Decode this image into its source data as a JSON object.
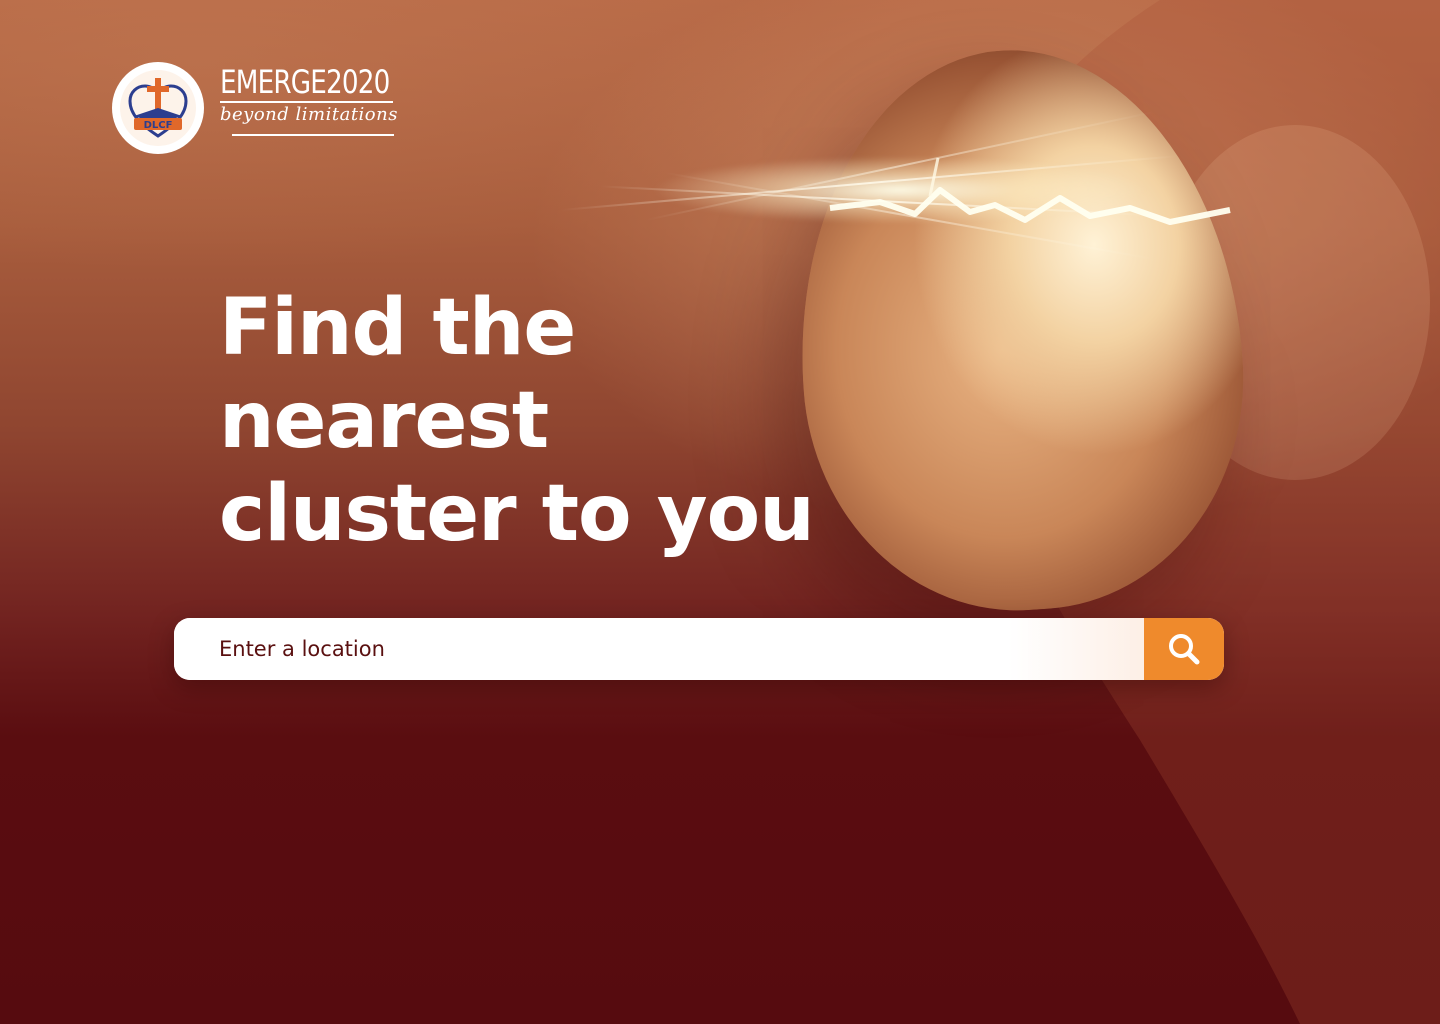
{
  "brand": {
    "name": "EMERGE2020",
    "tagline": "beyond limitations",
    "logo_text": "DLCF",
    "logo_icon": "cross-heart-logo"
  },
  "hero": {
    "headline_lines": [
      "Find the",
      "nearest",
      "cluster to you"
    ],
    "image": "cracked-egg-with-light"
  },
  "search": {
    "placeholder": "Enter a location",
    "value": "",
    "button_icon": "search-icon"
  },
  "colors": {
    "background_top": "#b86a47",
    "background_bottom": "#560b0f",
    "search_button": "#ef8a2c",
    "text_primary": "#ffffff",
    "placeholder_text": "#5a1010"
  }
}
